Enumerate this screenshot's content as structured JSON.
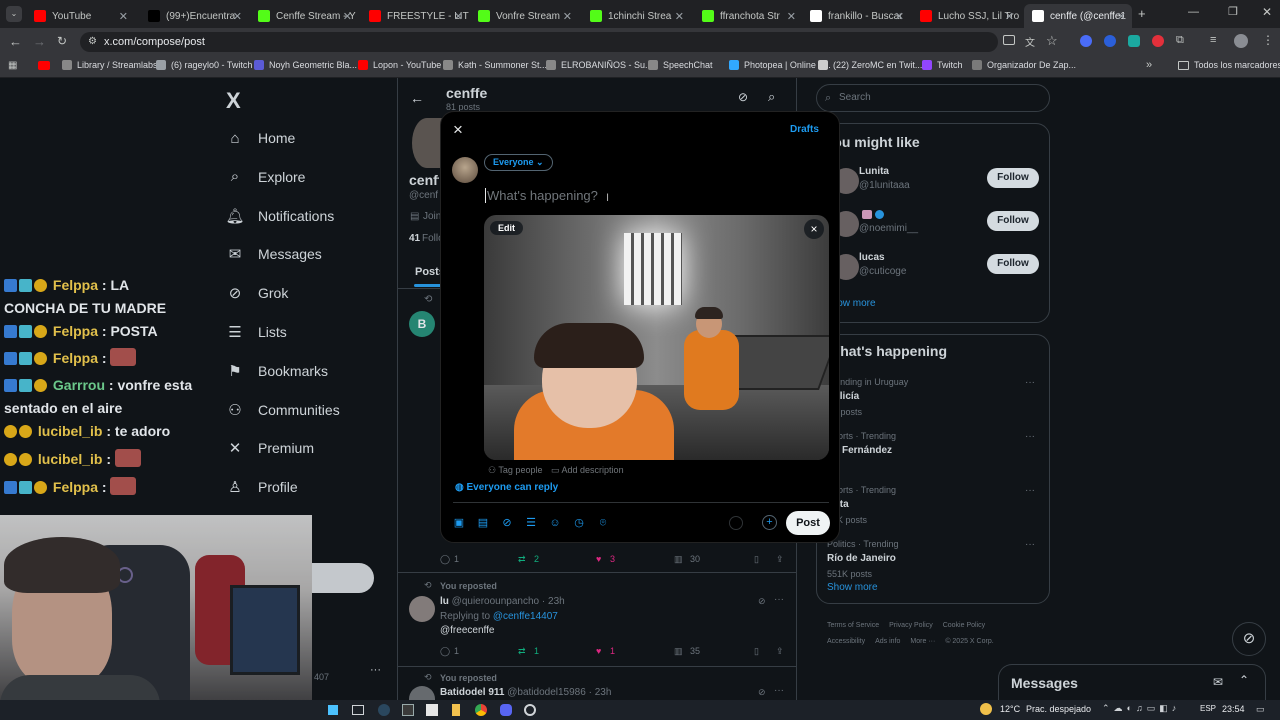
{
  "browser": {
    "tabs": [
      {
        "label": "YouTube",
        "color": "#ff0000"
      },
      {
        "label": "(99+)Encuentra ",
        "color": "#000000"
      },
      {
        "label": "Cenffe Stream - Y",
        "color": "#53fc18"
      },
      {
        "label": "FREESTYLE - LIT K",
        "color": "#ff0000"
      },
      {
        "label": "Vonfre Stream",
        "color": "#53fc18"
      },
      {
        "label": "1chinchi Strea",
        "color": "#53fc18"
      },
      {
        "label": "ffranchota Str",
        "color": "#53fc18"
      },
      {
        "label": "frankillo - Buscar",
        "color": "#ffffff"
      },
      {
        "label": "Lucho SSJ, Lil Tro",
        "color": "#ff0000"
      },
      {
        "label": "cenffe (@cenffe1",
        "color": "#ffffff"
      }
    ],
    "url": "x.com/compose/post",
    "bookmarks": [
      {
        "label": "Library / Streamlabs"
      },
      {
        "label": "(6) rageylo0 - Twitch"
      },
      {
        "label": "Noyh Geometric Bla..."
      },
      {
        "label": "Lopon - YouTube"
      },
      {
        "label": "Kәth - Summoner St..."
      },
      {
        "label": "ELROBANIÑOS - Su..."
      },
      {
        "label": "SpeechChat"
      },
      {
        "label": "Photopea | Online P..."
      },
      {
        "label": "(22) ZeroMC en Twit..."
      },
      {
        "label": "Twitch"
      },
      {
        "label": "Organizador De Zap..."
      }
    ],
    "all_bookmarks": "Todos los marcadores"
  },
  "nav": {
    "logo": "X",
    "items": [
      {
        "label": "Home",
        "icon": "home-icon"
      },
      {
        "label": "Explore",
        "icon": "search-icon"
      },
      {
        "label": "Notifications",
        "icon": "bell-icon"
      },
      {
        "label": "Messages",
        "icon": "mail-icon"
      },
      {
        "label": "Grok",
        "icon": "grok-icon"
      },
      {
        "label": "Lists",
        "icon": "list-icon"
      },
      {
        "label": "Bookmarks",
        "icon": "bookmark-icon"
      },
      {
        "label": "Communities",
        "icon": "people-icon"
      },
      {
        "label": "Premium",
        "icon": "x-icon"
      },
      {
        "label": "Profile",
        "icon": "person-icon"
      }
    ]
  },
  "chat": [
    {
      "name": "Felppa",
      "text": " : LA",
      "cont": "CONCHA DE TU MADRE"
    },
    {
      "name": "Felppa",
      "text": " : POSTA"
    },
    {
      "name": "Felppa",
      "text": " :"
    },
    {
      "name": "Garrrou",
      "text": " : vonfre esta",
      "cont": "sentado en el aire"
    },
    {
      "name": "lucibel_ib",
      "text": " : te adoro"
    },
    {
      "name": "lucibel_ib",
      "text": " :"
    },
    {
      "name": "Felppa",
      "text": " :"
    }
  ],
  "profile": {
    "name": "cenffe",
    "posts": "81 posts",
    "handle_partial": "@cenf",
    "joined_partial": "Join",
    "following_count": "41",
    "following_partial": "Follo",
    "tab_posts": "Posts",
    "avatar_letter": "B"
  },
  "feed": {
    "row1": {
      "replies": "1",
      "reposts": "2",
      "likes": "3",
      "views": "30"
    },
    "reposted": "You reposted",
    "post2": {
      "name": "lu",
      "handle": "@quieroounpancho",
      "time": "· 23h",
      "replying": "Replying to",
      "reply_to": "@cenffe14407",
      "text": "@freecenffe",
      "replies": "1",
      "reposts": "1",
      "likes": "1",
      "views": "35"
    },
    "reposted2": "You reposted",
    "post3": {
      "name": "Batidodel 911",
      "handle": "@batidodel15986",
      "time": "· 23h"
    }
  },
  "right": {
    "search_placeholder": "Search",
    "you_might_like": "You might like",
    "suggestions": [
      {
        "name": "Lunita",
        "handle": "@1lunitaaa"
      },
      {
        "name": "",
        "handle": "@noemimi__"
      },
      {
        "name": "lucas",
        "handle": "@cuticoge"
      }
    ],
    "follow": "Follow",
    "show_more": "Show more",
    "whats_happening": "What's happening",
    "trends": [
      {
        "meta": "Trending in Uruguay",
        "title": "Policía",
        "count": "8K posts"
      },
      {
        "meta": "Sports · Trending",
        "title": "Lo Fernández",
        "count": ""
      },
      {
        "meta": "Sports · Trending",
        "title": "Bata",
        "count": "13K posts"
      },
      {
        "meta": "Politics · Trending",
        "title": "Río de Janeiro",
        "count": "551K posts"
      }
    ],
    "show_more2": "Show more",
    "footer": [
      "Terms of Service",
      "Privacy Policy",
      "Cookie Policy",
      "Accessibility",
      "Ads info",
      "More ···",
      "© 2025 X Corp."
    ],
    "messages": "Messages"
  },
  "modal": {
    "close": "×",
    "drafts": "Drafts",
    "audience": "Everyone",
    "placeholder": "What's happening?",
    "edit": "Edit",
    "tag_people": "Tag people",
    "add_description": "Add description",
    "reply_setting": "Everyone can reply",
    "post": "Post"
  },
  "taskbar": {
    "temp": "12°C",
    "weather": "Prac. despejado",
    "lang": "ESP",
    "time": "23:54"
  },
  "webcam_label": "407",
  "colors": {
    "accent": "#1d9bf0",
    "like": "#f91880",
    "repost": "#00ba7c"
  }
}
